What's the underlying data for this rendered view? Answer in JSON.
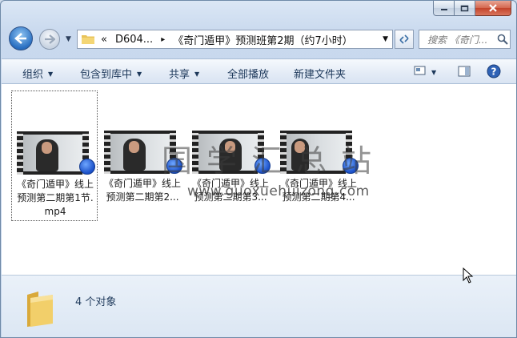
{
  "window": {
    "caption_buttons": {
      "minimize": "minimize-icon",
      "maximize": "maximize-icon",
      "close": "close-icon"
    }
  },
  "nav": {
    "back_icon": "back-arrow-icon",
    "forward_icon": "forward-arrow-icon",
    "address": {
      "prefix": "«",
      "segment1": "D604...",
      "separator": "▸",
      "segment2": "《奇门遁甲》预测班第2期（约7小时）"
    },
    "search_placeholder": "搜索 《奇门..."
  },
  "toolbar": {
    "organize": "组织",
    "include_library": "包含到库中",
    "share": "共享",
    "play_all": "全部播放",
    "new_folder": "新建文件夹"
  },
  "files": [
    {
      "line1": "《奇门遁甲》线上",
      "line2": "预测第二期第1节.",
      "line3": "mp4",
      "selected": true
    },
    {
      "line1": "《奇门遁甲》线上",
      "line2": "预测第二期第2...",
      "line3": "",
      "selected": false
    },
    {
      "line1": "《奇门遁甲》线上",
      "line2": "预测第二期第3...",
      "line3": "",
      "selected": false
    },
    {
      "line1": "《奇门遁甲》线上",
      "line2": "预测第二期第4...",
      "line3": "",
      "selected": false
    }
  ],
  "watermark": {
    "cn": "国学汇总站",
    "url": "www.guoxuehuizong.com"
  },
  "status": {
    "count": "4 个对象"
  },
  "colors": {
    "accent": "#1e395b",
    "selection_border": "#555555"
  }
}
